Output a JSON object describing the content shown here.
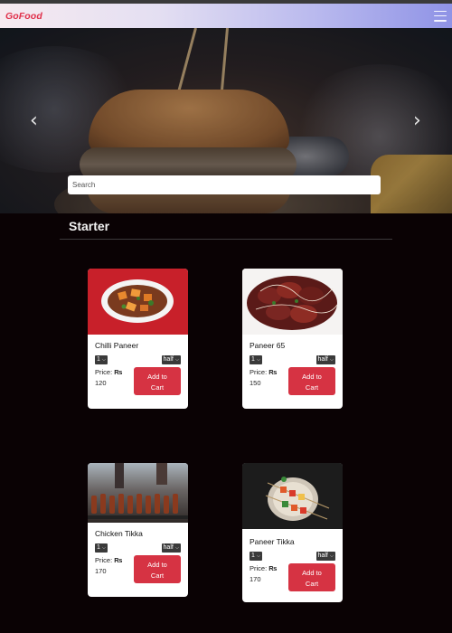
{
  "navbar": {
    "brand": "GoFood"
  },
  "search": {
    "placeholder": "Search"
  },
  "section": {
    "title": "Starter"
  },
  "items": [
    {
      "name": "Chilli Paneer",
      "qty": "1",
      "size": "half",
      "price_label": "Price: ",
      "currency": "₨",
      "price": "120",
      "button_line1": "Add to",
      "button_line2": "Cart"
    },
    {
      "name": "Paneer 65",
      "qty": "1",
      "size": "half",
      "price_label": "Price: ",
      "currency": "₨",
      "price": "150",
      "button_line1": "Add to",
      "button_line2": "Cart"
    },
    {
      "name": "Chicken Tikka",
      "qty": "1",
      "size": "half",
      "price_label": "Price: ",
      "currency": "₨",
      "price": "170",
      "button_line1": "Add to",
      "button_line2": "Cart"
    },
    {
      "name": "Paneer Tikka",
      "qty": "1",
      "size": "half",
      "price_label": "Price: ",
      "currency": "₨",
      "price": "170",
      "button_line1": "Add to",
      "button_line2": "Cart"
    }
  ],
  "icons": {
    "prev": "chevron-left-icon",
    "next": "chevron-right-icon",
    "menu": "hamburger-icon",
    "dropdown": "chevron-down-icon"
  },
  "colors": {
    "brand": "#e0304a",
    "accent_button": "#d63343",
    "background": "#0a0204"
  }
}
